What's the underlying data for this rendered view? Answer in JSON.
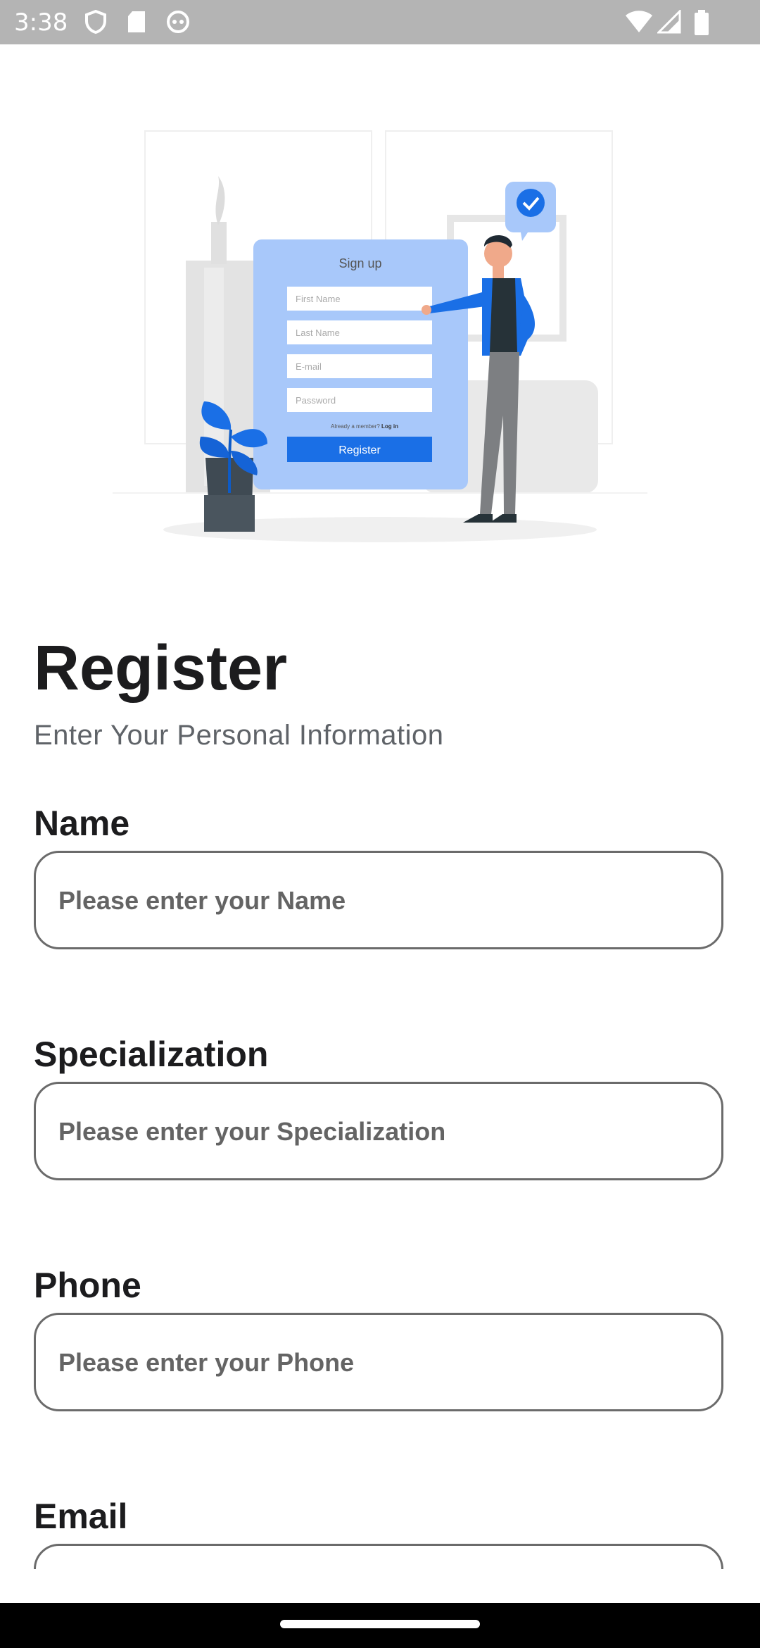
{
  "status_bar": {
    "time": "3:38"
  },
  "illustration": {
    "card_title": "Sign up",
    "fields": [
      "First Name",
      "Last Name",
      "E-mail",
      "Password"
    ],
    "login_prompt": "Already a member?",
    "login_link": "Log in",
    "button_label": "Register"
  },
  "header": {
    "title": "Register",
    "subtitle": "Enter Your Personal Information"
  },
  "form": {
    "name": {
      "label": "Name",
      "placeholder": "Please enter your Name"
    },
    "specialization": {
      "label": "Specialization",
      "placeholder": "Please enter your Specialization"
    },
    "phone": {
      "label": "Phone",
      "placeholder": "Please enter your Phone"
    },
    "email": {
      "label": "Email"
    }
  },
  "colors": {
    "status_bar": "#b4b4b4",
    "accent_blue": "#1a6fe6",
    "card_blue": "#a8c8fa",
    "text_dark": "#1c1c1e",
    "border": "#6b6b6b"
  }
}
